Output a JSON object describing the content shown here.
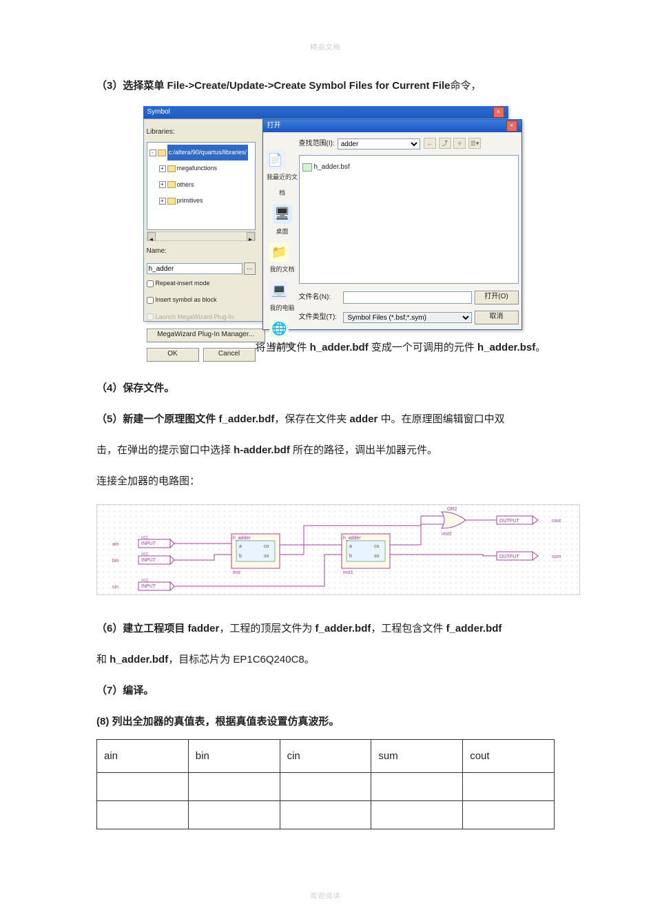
{
  "watermark_top": "精品文档",
  "watermark_bottom": "欢迎阅读",
  "step3_pre": "（3）选择菜单 ",
  "step3_menu": "File->Create/Update->Create Symbol Files for Current File",
  "step3_post": "命令，",
  "symbolDlg": {
    "title": "Symbol",
    "librariesLabel": "Libraries:",
    "selectedPath": "c:/altera/90/quartus/libraries/",
    "tree": [
      "megafunctions",
      "others",
      "primitives"
    ],
    "nameLabel": "Name:",
    "nameValue": "h_adder",
    "repeat": "Repeat-insert mode",
    "insertBlock": "Insert symbol as block",
    "launch": "Launch MegaWizard Plug-In",
    "megawizard": "MegaWizard Plug-In Manager...",
    "ok": "OK",
    "cancel": "Cancel"
  },
  "openDlg": {
    "title": "打开",
    "lookInLabel": "查找范围(I):",
    "folder": "adder",
    "fileItem": "h_adder.bsf",
    "side": [
      "我最近的文档",
      "桌面",
      "我的文档",
      "我的电脑",
      "网上邻居"
    ],
    "fileNameLabel": "文件名(N):",
    "fileTypeLabel": "文件类型(T):",
    "fileNameValue": "",
    "fileTypeValue": "Symbol Files (*.bsf;*.sym)",
    "openBtn": "打开(O)",
    "cancelBtn": "取消"
  },
  "line_after_dlg_pre": "将当前文件 ",
  "line_after_dlg_f1": "h_adder.bdf",
  "line_after_dlg_mid": " 变成一个可调用的元件 ",
  "line_after_dlg_f2": "h_adder.bsf",
  "line_after_dlg_end": "。",
  "step4": "（4）保存文件。",
  "step5_pre": "（5）新建一个原理图文件 ",
  "step5_f1": "f_adder.bdf",
  "step5_mid1": "，保存在文件夹 ",
  "step5_folder": "adder",
  "step5_mid2": " 中。在原理图编辑窗口中双",
  "step5_line2_pre": "击，在弹出的提示窗口中选择 ",
  "step5_line2_f": "h-adder.bdf",
  "step5_line2_post": " 所在的路径，调出半加器元件。",
  "circuit_title": "连接全加器的电路图：",
  "schematic": {
    "inputs": [
      "ain",
      "bin",
      "cin"
    ],
    "blocks": [
      "h_adder",
      "h_adder"
    ],
    "block_insts": [
      "inst",
      "inst1"
    ],
    "block_ports_left": [
      "a",
      "b"
    ],
    "block_ports_right": [
      "co",
      "so"
    ],
    "gate": "OR2",
    "gate_inst": "inst2",
    "outputs": [
      "cout",
      "sum"
    ],
    "pin_type_in": "INPUT",
    "pin_type_out": "OUTPUT",
    "vcc": "VCC"
  },
  "step6_pre": "（6）建立工程项目 ",
  "step6_proj": "fadder",
  "step6_mid1": "，工程的顶层文件为 ",
  "step6_f1": "f_adder.bdf",
  "step6_mid2": "，工程包含文件 ",
  "step6_f2": "f_adder.bdf",
  "step6_line2_pre": "和 ",
  "step6_line2_f": "h_adder.bdf",
  "step6_line2_post": "，目标芯片为 EP1C6Q240C8。",
  "step7": "（7）编译。",
  "step8": "(8) 列出全加器的真值表，根据真值表设置仿真波形。",
  "table_headers": [
    "ain",
    "bin",
    "cin",
    "sum",
    "cout"
  ]
}
